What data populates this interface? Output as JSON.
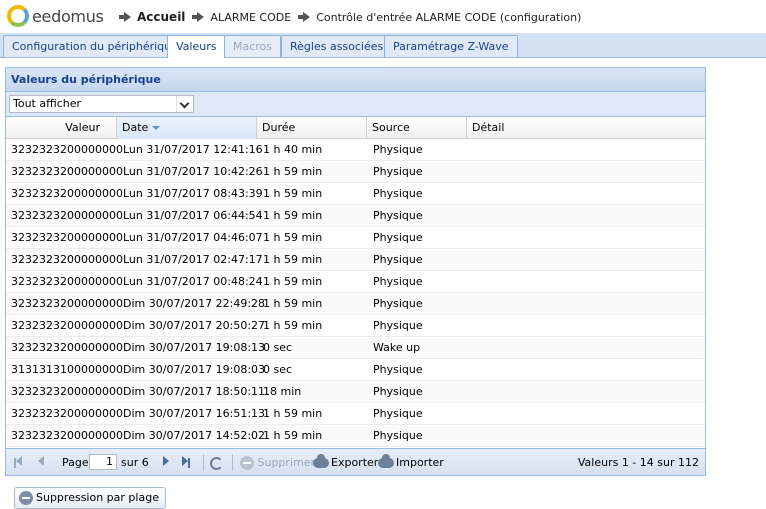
{
  "header": {
    "logo_text": "eedomus",
    "breadcrumbs": [
      "Accueil",
      "ALARME CODE",
      "Contrôle d'entrée ALARME CODE (configuration)"
    ]
  },
  "tabs": [
    {
      "label": "Configuration du périphérique",
      "state": "normal"
    },
    {
      "label": "Valeurs",
      "state": "active"
    },
    {
      "label": "Macros",
      "state": "disabled"
    },
    {
      "label": "Règles associées",
      "state": "normal"
    },
    {
      "label": "Paramétrage Z-Wave",
      "state": "normal"
    }
  ],
  "panel": {
    "title": "Valeurs du périphérique",
    "filter_value": "Tout afficher"
  },
  "grid": {
    "columns": [
      "Valeur",
      "Date",
      "Durée",
      "Source",
      "Détail"
    ],
    "sorted_column": "Date",
    "rows": [
      {
        "valeur": "3232323200000000",
        "date": "Lun 31/07/2017 12:41:16",
        "duree": "1 h 40 min",
        "source": "Physique"
      },
      {
        "valeur": "3232323200000000",
        "date": "Lun 31/07/2017 10:42:26",
        "duree": "1 h 59 min",
        "source": "Physique"
      },
      {
        "valeur": "3232323200000000",
        "date": "Lun 31/07/2017 08:43:39",
        "duree": "1 h 59 min",
        "source": "Physique"
      },
      {
        "valeur": "3232323200000000",
        "date": "Lun 31/07/2017 06:44:54",
        "duree": "1 h 59 min",
        "source": "Physique"
      },
      {
        "valeur": "3232323200000000",
        "date": "Lun 31/07/2017 04:46:07",
        "duree": "1 h 59 min",
        "source": "Physique"
      },
      {
        "valeur": "3232323200000000",
        "date": "Lun 31/07/2017 02:47:17",
        "duree": "1 h 59 min",
        "source": "Physique"
      },
      {
        "valeur": "3232323200000000",
        "date": "Lun 31/07/2017 00:48:24",
        "duree": "1 h 59 min",
        "source": "Physique"
      },
      {
        "valeur": "3232323200000000",
        "date": "Dim 30/07/2017 22:49:28",
        "duree": "1 h 59 min",
        "source": "Physique"
      },
      {
        "valeur": "3232323200000000",
        "date": "Dim 30/07/2017 20:50:27",
        "duree": "1 h 59 min",
        "source": "Physique"
      },
      {
        "valeur": "3232323200000000",
        "date": "Dim 30/07/2017 19:08:13",
        "duree": "0 sec",
        "source": "Wake up"
      },
      {
        "valeur": "3131313100000000",
        "date": "Dim 30/07/2017 19:08:03",
        "duree": "0 sec",
        "source": "Physique"
      },
      {
        "valeur": "3232323200000000",
        "date": "Dim 30/07/2017 18:50:11",
        "duree": "18 min",
        "source": "Physique"
      },
      {
        "valeur": "3232323200000000",
        "date": "Dim 30/07/2017 16:51:13",
        "duree": "1 h 59 min",
        "source": "Physique"
      },
      {
        "valeur": "3232323200000000",
        "date": "Dim 30/07/2017 14:52:02",
        "duree": "1 h 59 min",
        "source": "Physique"
      }
    ]
  },
  "pager": {
    "page_label": "Page",
    "page_value": "1",
    "of_label": "sur 6",
    "delete_label": "Supprimer",
    "export_label": "Exporter",
    "import_label": "Importer",
    "summary": "Valeurs 1 - 14 sur 112"
  },
  "bottom_button": {
    "label": "Suppression par plage"
  },
  "icons": {
    "first": "first-page-icon",
    "prev": "prev-page-icon",
    "next": "next-page-icon",
    "last": "last-page-icon",
    "refresh": "refresh-icon",
    "delete": "delete-icon",
    "export": "cloud-download-icon",
    "import": "cloud-upload-icon"
  },
  "colors": {
    "accent": "#15428b",
    "border": "#99bbe8",
    "tabbar": "#d4e1f2"
  }
}
